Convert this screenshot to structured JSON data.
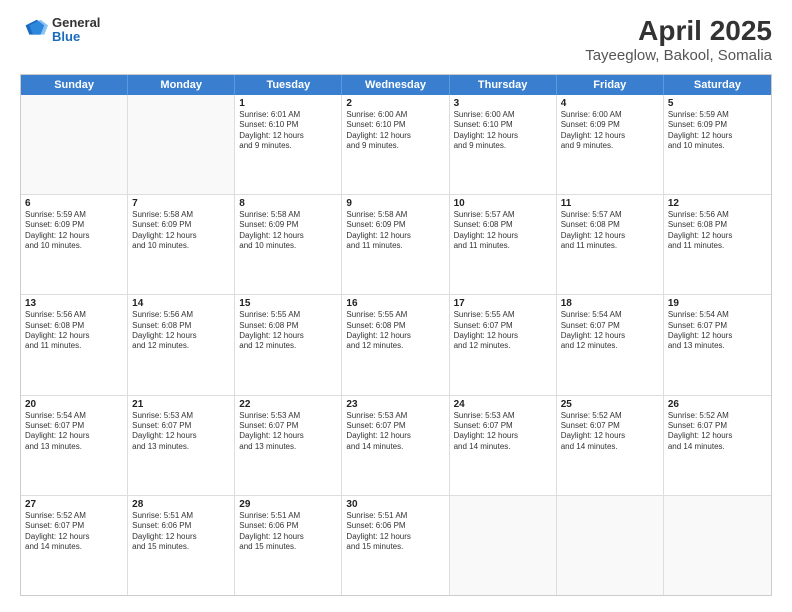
{
  "header": {
    "logo": {
      "general": "General",
      "blue": "Blue"
    },
    "title": "April 2025",
    "subtitle": "Tayeeglow, Bakool, Somalia"
  },
  "calendar": {
    "days_of_week": [
      "Sunday",
      "Monday",
      "Tuesday",
      "Wednesday",
      "Thursday",
      "Friday",
      "Saturday"
    ],
    "weeks": [
      [
        {
          "day": "",
          "info": ""
        },
        {
          "day": "",
          "info": ""
        },
        {
          "day": "1",
          "info": "Sunrise: 6:01 AM\nSunset: 6:10 PM\nDaylight: 12 hours\nand 9 minutes."
        },
        {
          "day": "2",
          "info": "Sunrise: 6:00 AM\nSunset: 6:10 PM\nDaylight: 12 hours\nand 9 minutes."
        },
        {
          "day": "3",
          "info": "Sunrise: 6:00 AM\nSunset: 6:10 PM\nDaylight: 12 hours\nand 9 minutes."
        },
        {
          "day": "4",
          "info": "Sunrise: 6:00 AM\nSunset: 6:09 PM\nDaylight: 12 hours\nand 9 minutes."
        },
        {
          "day": "5",
          "info": "Sunrise: 5:59 AM\nSunset: 6:09 PM\nDaylight: 12 hours\nand 10 minutes."
        }
      ],
      [
        {
          "day": "6",
          "info": "Sunrise: 5:59 AM\nSunset: 6:09 PM\nDaylight: 12 hours\nand 10 minutes."
        },
        {
          "day": "7",
          "info": "Sunrise: 5:58 AM\nSunset: 6:09 PM\nDaylight: 12 hours\nand 10 minutes."
        },
        {
          "day": "8",
          "info": "Sunrise: 5:58 AM\nSunset: 6:09 PM\nDaylight: 12 hours\nand 10 minutes."
        },
        {
          "day": "9",
          "info": "Sunrise: 5:58 AM\nSunset: 6:09 PM\nDaylight: 12 hours\nand 11 minutes."
        },
        {
          "day": "10",
          "info": "Sunrise: 5:57 AM\nSunset: 6:08 PM\nDaylight: 12 hours\nand 11 minutes."
        },
        {
          "day": "11",
          "info": "Sunrise: 5:57 AM\nSunset: 6:08 PM\nDaylight: 12 hours\nand 11 minutes."
        },
        {
          "day": "12",
          "info": "Sunrise: 5:56 AM\nSunset: 6:08 PM\nDaylight: 12 hours\nand 11 minutes."
        }
      ],
      [
        {
          "day": "13",
          "info": "Sunrise: 5:56 AM\nSunset: 6:08 PM\nDaylight: 12 hours\nand 11 minutes."
        },
        {
          "day": "14",
          "info": "Sunrise: 5:56 AM\nSunset: 6:08 PM\nDaylight: 12 hours\nand 12 minutes."
        },
        {
          "day": "15",
          "info": "Sunrise: 5:55 AM\nSunset: 6:08 PM\nDaylight: 12 hours\nand 12 minutes."
        },
        {
          "day": "16",
          "info": "Sunrise: 5:55 AM\nSunset: 6:08 PM\nDaylight: 12 hours\nand 12 minutes."
        },
        {
          "day": "17",
          "info": "Sunrise: 5:55 AM\nSunset: 6:07 PM\nDaylight: 12 hours\nand 12 minutes."
        },
        {
          "day": "18",
          "info": "Sunrise: 5:54 AM\nSunset: 6:07 PM\nDaylight: 12 hours\nand 12 minutes."
        },
        {
          "day": "19",
          "info": "Sunrise: 5:54 AM\nSunset: 6:07 PM\nDaylight: 12 hours\nand 13 minutes."
        }
      ],
      [
        {
          "day": "20",
          "info": "Sunrise: 5:54 AM\nSunset: 6:07 PM\nDaylight: 12 hours\nand 13 minutes."
        },
        {
          "day": "21",
          "info": "Sunrise: 5:53 AM\nSunset: 6:07 PM\nDaylight: 12 hours\nand 13 minutes."
        },
        {
          "day": "22",
          "info": "Sunrise: 5:53 AM\nSunset: 6:07 PM\nDaylight: 12 hours\nand 13 minutes."
        },
        {
          "day": "23",
          "info": "Sunrise: 5:53 AM\nSunset: 6:07 PM\nDaylight: 12 hours\nand 14 minutes."
        },
        {
          "day": "24",
          "info": "Sunrise: 5:53 AM\nSunset: 6:07 PM\nDaylight: 12 hours\nand 14 minutes."
        },
        {
          "day": "25",
          "info": "Sunrise: 5:52 AM\nSunset: 6:07 PM\nDaylight: 12 hours\nand 14 minutes."
        },
        {
          "day": "26",
          "info": "Sunrise: 5:52 AM\nSunset: 6:07 PM\nDaylight: 12 hours\nand 14 minutes."
        }
      ],
      [
        {
          "day": "27",
          "info": "Sunrise: 5:52 AM\nSunset: 6:07 PM\nDaylight: 12 hours\nand 14 minutes."
        },
        {
          "day": "28",
          "info": "Sunrise: 5:51 AM\nSunset: 6:06 PM\nDaylight: 12 hours\nand 15 minutes."
        },
        {
          "day": "29",
          "info": "Sunrise: 5:51 AM\nSunset: 6:06 PM\nDaylight: 12 hours\nand 15 minutes."
        },
        {
          "day": "30",
          "info": "Sunrise: 5:51 AM\nSunset: 6:06 PM\nDaylight: 12 hours\nand 15 minutes."
        },
        {
          "day": "",
          "info": ""
        },
        {
          "day": "",
          "info": ""
        },
        {
          "day": "",
          "info": ""
        }
      ]
    ]
  }
}
